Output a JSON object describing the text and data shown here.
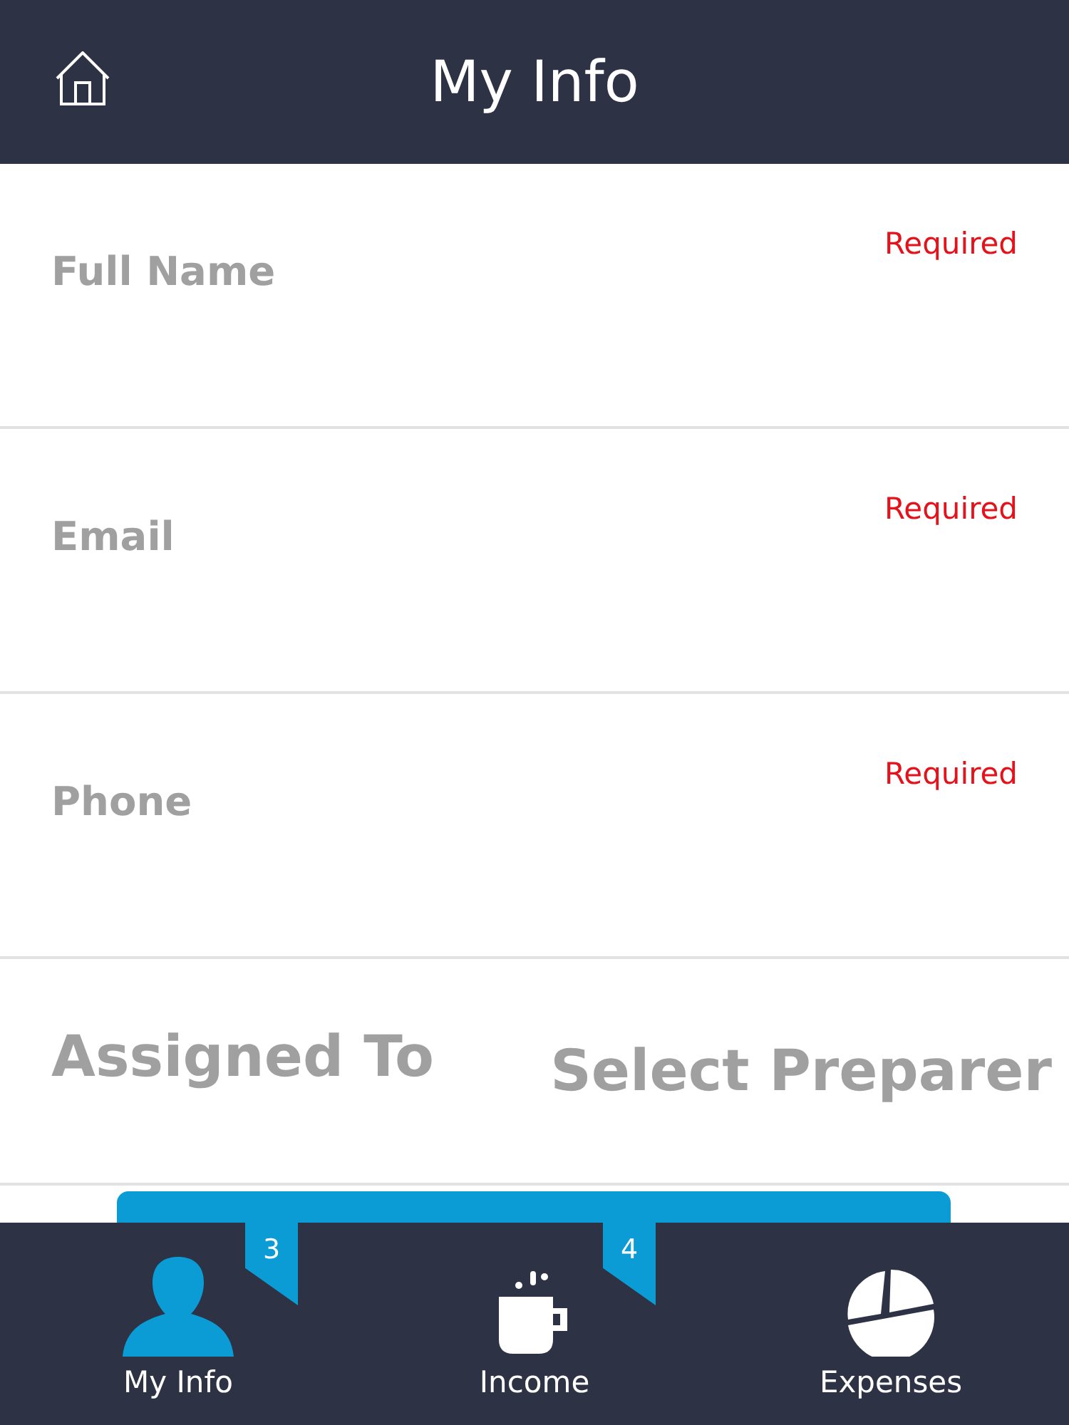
{
  "header": {
    "title": "My Info"
  },
  "fields": [
    {
      "label": "Full Name",
      "note": "Required"
    },
    {
      "label": "Email",
      "note": "Required"
    },
    {
      "label": "Phone",
      "note": "Required"
    }
  ],
  "assignment": {
    "label": "Assigned To",
    "value": "Select Preparer"
  },
  "tabs": [
    {
      "label": "My Info",
      "selected": true,
      "badge": "3",
      "kind": "person"
    },
    {
      "label": "Income",
      "selected": false,
      "badge": "4",
      "kind": "cup"
    },
    {
      "label": "Expenses",
      "selected": false,
      "kind": "pie"
    }
  ]
}
